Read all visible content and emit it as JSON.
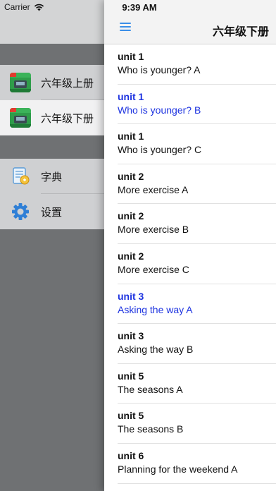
{
  "status": {
    "carrier": "Carrier",
    "time": "9:39 AM"
  },
  "drawer": {
    "books": [
      {
        "label": "六年级上册",
        "selected": false
      },
      {
        "label": "六年级下册",
        "selected": true
      }
    ],
    "tools": [
      {
        "label": "字典",
        "icon": "dictionary-icon"
      },
      {
        "label": "设置",
        "icon": "gear-icon"
      }
    ]
  },
  "header": {
    "title": "六年级下册"
  },
  "lessons": [
    {
      "unit": "unit 1",
      "title": "Who is younger? A",
      "highlighted": false
    },
    {
      "unit": "unit 1",
      "title": "Who is younger? B",
      "highlighted": true
    },
    {
      "unit": "unit 1",
      "title": "Who is younger? C",
      "highlighted": false
    },
    {
      "unit": "unit 2",
      "title": "More exercise A",
      "highlighted": false
    },
    {
      "unit": "unit 2",
      "title": "More exercise B",
      "highlighted": false
    },
    {
      "unit": "unit 2",
      "title": "More exercise C",
      "highlighted": false
    },
    {
      "unit": "unit 3",
      "title": "Asking the way A",
      "highlighted": true
    },
    {
      "unit": "unit 3",
      "title": "Asking the way B",
      "highlighted": false
    },
    {
      "unit": "unit 5",
      "title": "The seasons A",
      "highlighted": false
    },
    {
      "unit": "unit 5",
      "title": "The seasons B",
      "highlighted": false
    },
    {
      "unit": "unit 6",
      "title": "Planning for the weekend A",
      "highlighted": false
    }
  ],
  "colors": {
    "accent": "#3b8fe8",
    "highlight_text": "#1d33e0",
    "drawer_bg": "#6f7173"
  }
}
